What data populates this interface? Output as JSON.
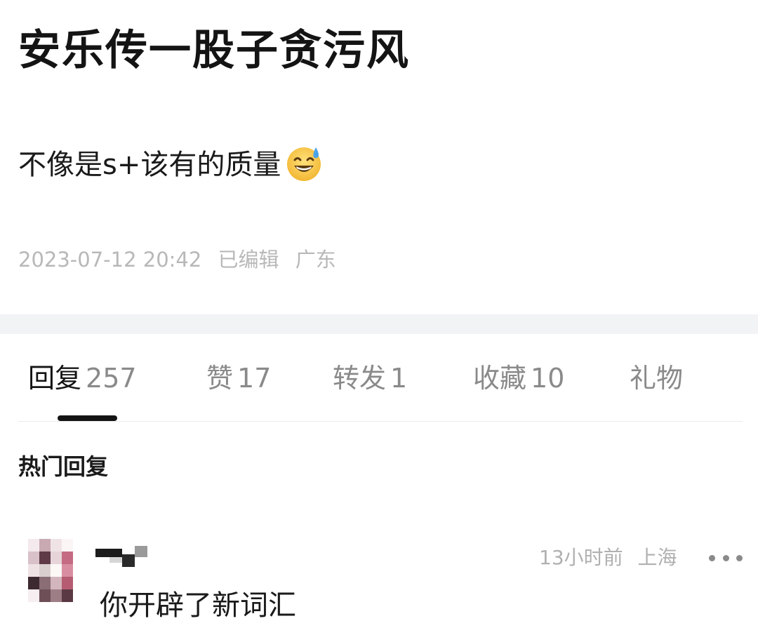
{
  "post": {
    "title": "安乐传一股子贪污风",
    "body": "不像是s+该有的质量",
    "body_emoji": "grinning-sweat-emoji",
    "timestamp": "2023-07-12 20:42",
    "edited": "已编辑",
    "location": "广东"
  },
  "tabs": [
    {
      "label": "回复",
      "count": "257",
      "active": true
    },
    {
      "label": "赞",
      "count": "17",
      "active": false
    },
    {
      "label": "转发",
      "count": "1",
      "active": false
    },
    {
      "label": "收藏",
      "count": "10",
      "active": false
    },
    {
      "label": "礼物",
      "count": "",
      "active": false
    }
  ],
  "hot_replies": {
    "title": "热门回复"
  },
  "comment": {
    "avatar_icon": "pixelated-avatar",
    "username_icon": "pixelated-username",
    "time": "13小时前",
    "location": "上海",
    "more_icon": "more-dots-icon",
    "text": "你开辟了新词汇"
  },
  "colors": {
    "text_primary": "#141414",
    "text_secondary": "#8a8a8a",
    "meta_gray": "#b8b8b8",
    "divider_band": "#f1f3f5",
    "emoji_yellow": "#f7c744",
    "emoji_sweat": "#4aa3e8"
  }
}
